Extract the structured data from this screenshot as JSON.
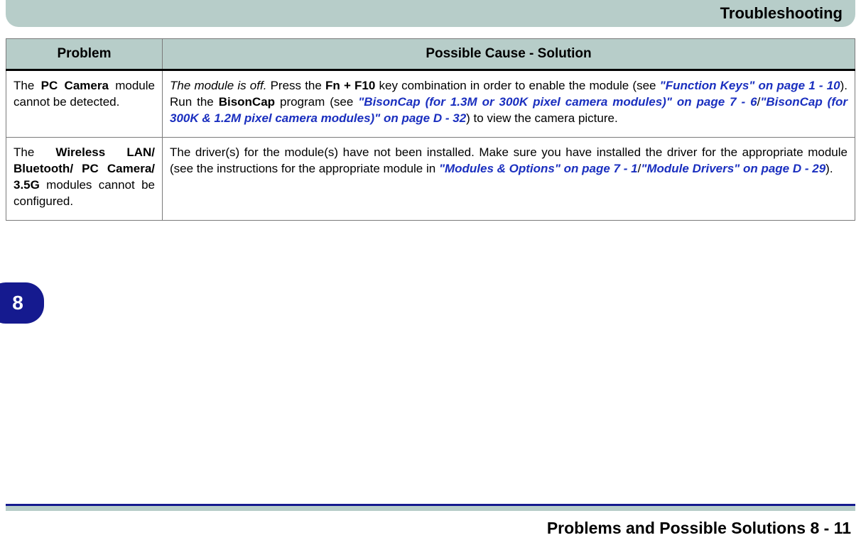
{
  "header": {
    "title": "Troubleshooting"
  },
  "table": {
    "headers": {
      "problem": "Problem",
      "solution": "Possible Cause - Solution"
    },
    "rows": [
      {
        "p_pre": "The ",
        "p_b1": "PC Camera",
        "p_post": " module cannot be detected.",
        "s_i1": "The module is off.",
        "s_t1": " Press the ",
        "s_b1": "Fn + F10",
        "s_t2": " key combination in order to enable the module (see ",
        "s_l1": "\"Function Keys\" on page 1 - 10",
        "s_t3": "). Run the ",
        "s_b2": "BisonCap",
        "s_t4": " program (see ",
        "s_l2": "\"BisonCap (for 1.3M or 300K pixel camera modules)\" on page 7 - 6",
        "s_t5": "/",
        "s_l3": "\"BisonCap (for 300K & 1.2M pixel camera modules)\" on page D - 32",
        "s_t6": ") to view the camera picture."
      },
      {
        "p_pre": "The ",
        "p_b1": "Wireless LAN/ Bluetooth/ PC Camera/ 3.5G",
        "p_post": " modules cannot be configured.",
        "s_t1": "The driver(s) for the module(s) have not been installed. Make sure you have installed the driver for the appropriate module (see the instructions for the appropriate module in ",
        "s_l1": "\"Modules & Options\" on page 7 - 1",
        "s_t2": "/",
        "s_l2": "\"Module Drivers\" on page D - 29",
        "s_t3": ")."
      }
    ]
  },
  "sidetab": {
    "label": "8"
  },
  "footer": {
    "text": "Problems and Possible Solutions  8  -  11"
  }
}
